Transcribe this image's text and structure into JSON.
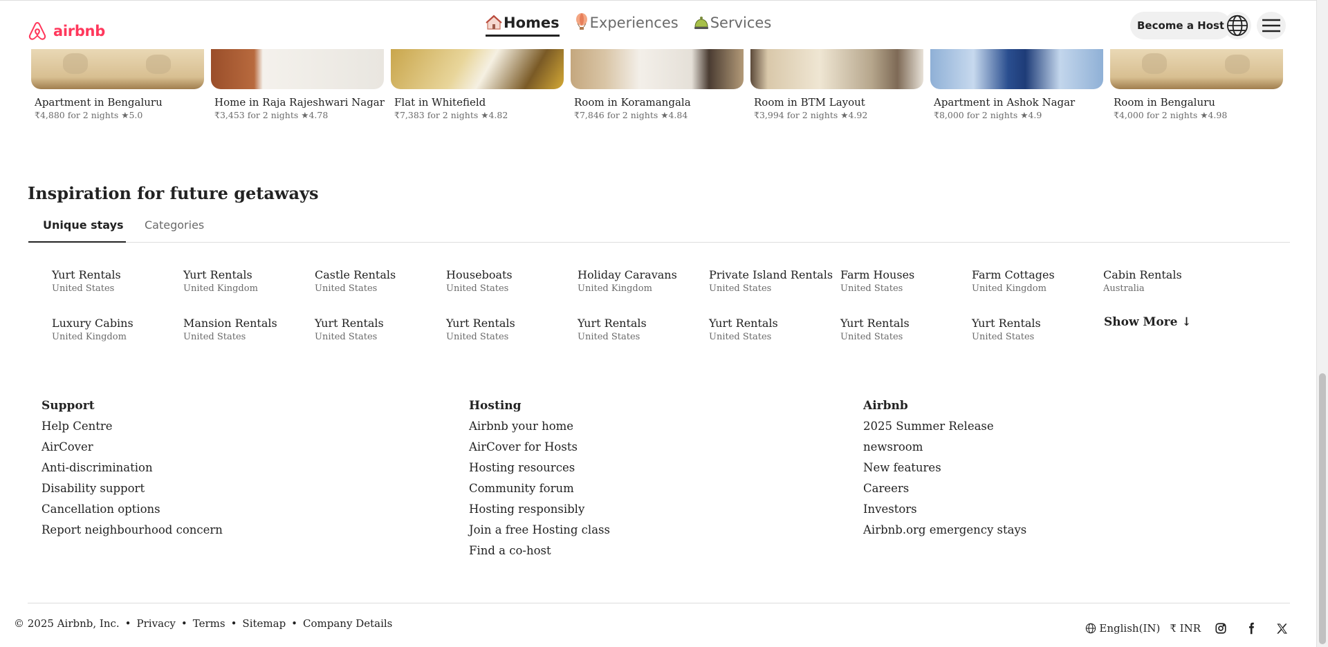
{
  "header": {
    "brand": "airbnb",
    "nav": [
      {
        "label": "Homes",
        "icon": "house-icon",
        "active": true
      },
      {
        "label": "Experiences",
        "icon": "balloon-icon",
        "active": false
      },
      {
        "label": "Services",
        "icon": "bell-icon",
        "active": false
      }
    ],
    "host_label": "Become a Host"
  },
  "listings": [
    {
      "title": "Apartment in Bengaluru",
      "meta": "₹4,880 for 2 nights ★5.0"
    },
    {
      "title": "Home in Raja Rajeshwari Nagar",
      "meta": "₹3,453 for 2 nights ★4.78"
    },
    {
      "title": "Flat in Whitefield",
      "meta": "₹7,383 for 2 nights ★4.82"
    },
    {
      "title": "Room in Koramangala",
      "meta": "₹7,846 for 2 nights ★4.84"
    },
    {
      "title": "Room in BTM Layout",
      "meta": "₹3,994 for 2 nights ★4.92"
    },
    {
      "title": "Apartment in Ashok Nagar",
      "meta": "₹8,000 for 2 nights ★4.9"
    },
    {
      "title": "Room in Bengaluru",
      "meta": "₹4,000 for 2 nights ★4.98"
    }
  ],
  "inspiration": {
    "title": "Inspiration for future getaways",
    "tabs": [
      "Unique stays",
      "Categories"
    ],
    "items": [
      {
        "name": "Yurt Rentals",
        "loc": "United States"
      },
      {
        "name": "Yurt Rentals",
        "loc": "United Kingdom"
      },
      {
        "name": "Castle Rentals",
        "loc": "United States"
      },
      {
        "name": "Houseboats",
        "loc": "United States"
      },
      {
        "name": "Holiday Caravans",
        "loc": "United Kingdom"
      },
      {
        "name": "Private Island Rentals",
        "loc": "United States"
      },
      {
        "name": "Farm Houses",
        "loc": "United States"
      },
      {
        "name": "Farm Cottages",
        "loc": "United Kingdom"
      },
      {
        "name": "Cabin Rentals",
        "loc": "Australia"
      },
      {
        "name": "Luxury Cabins",
        "loc": "United Kingdom"
      },
      {
        "name": "Mansion Rentals",
        "loc": "United States"
      },
      {
        "name": "Yurt Rentals",
        "loc": "United States"
      },
      {
        "name": "Yurt Rentals",
        "loc": "United States"
      },
      {
        "name": "Yurt Rentals",
        "loc": "United States"
      },
      {
        "name": "Yurt Rentals",
        "loc": "United States"
      },
      {
        "name": "Yurt Rentals",
        "loc": "United States"
      },
      {
        "name": "Yurt Rentals",
        "loc": "United States"
      }
    ],
    "show_more": "Show More ↓"
  },
  "footer": {
    "support": {
      "heading": "Support",
      "links": [
        "Help Centre",
        "AirCover",
        "Anti-discrimination",
        "Disability support",
        "Cancellation options",
        "Report neighbourhood concern"
      ]
    },
    "hosting": {
      "heading": "Hosting",
      "links": [
        "Airbnb your home",
        "AirCover for Hosts",
        "Hosting resources",
        "Community forum",
        "Hosting responsibly",
        "Join a free Hosting class",
        "Find a co-host"
      ]
    },
    "airbnb": {
      "heading": "Airbnb",
      "links": [
        "2025 Summer Release",
        "newsroom",
        "New features",
        "Careers",
        "Investors",
        "Airbnb.org emergency stays"
      ]
    },
    "copyright": "© 2025 Airbnb, Inc.",
    "legal_links": [
      "Privacy",
      "Terms",
      "Sitemap",
      "Company Details"
    ],
    "language": "English(IN)",
    "currency": "₹ INR"
  },
  "colors": {
    "brand": "#ff385c",
    "text": "#222222",
    "muted": "#6a6a6a"
  }
}
